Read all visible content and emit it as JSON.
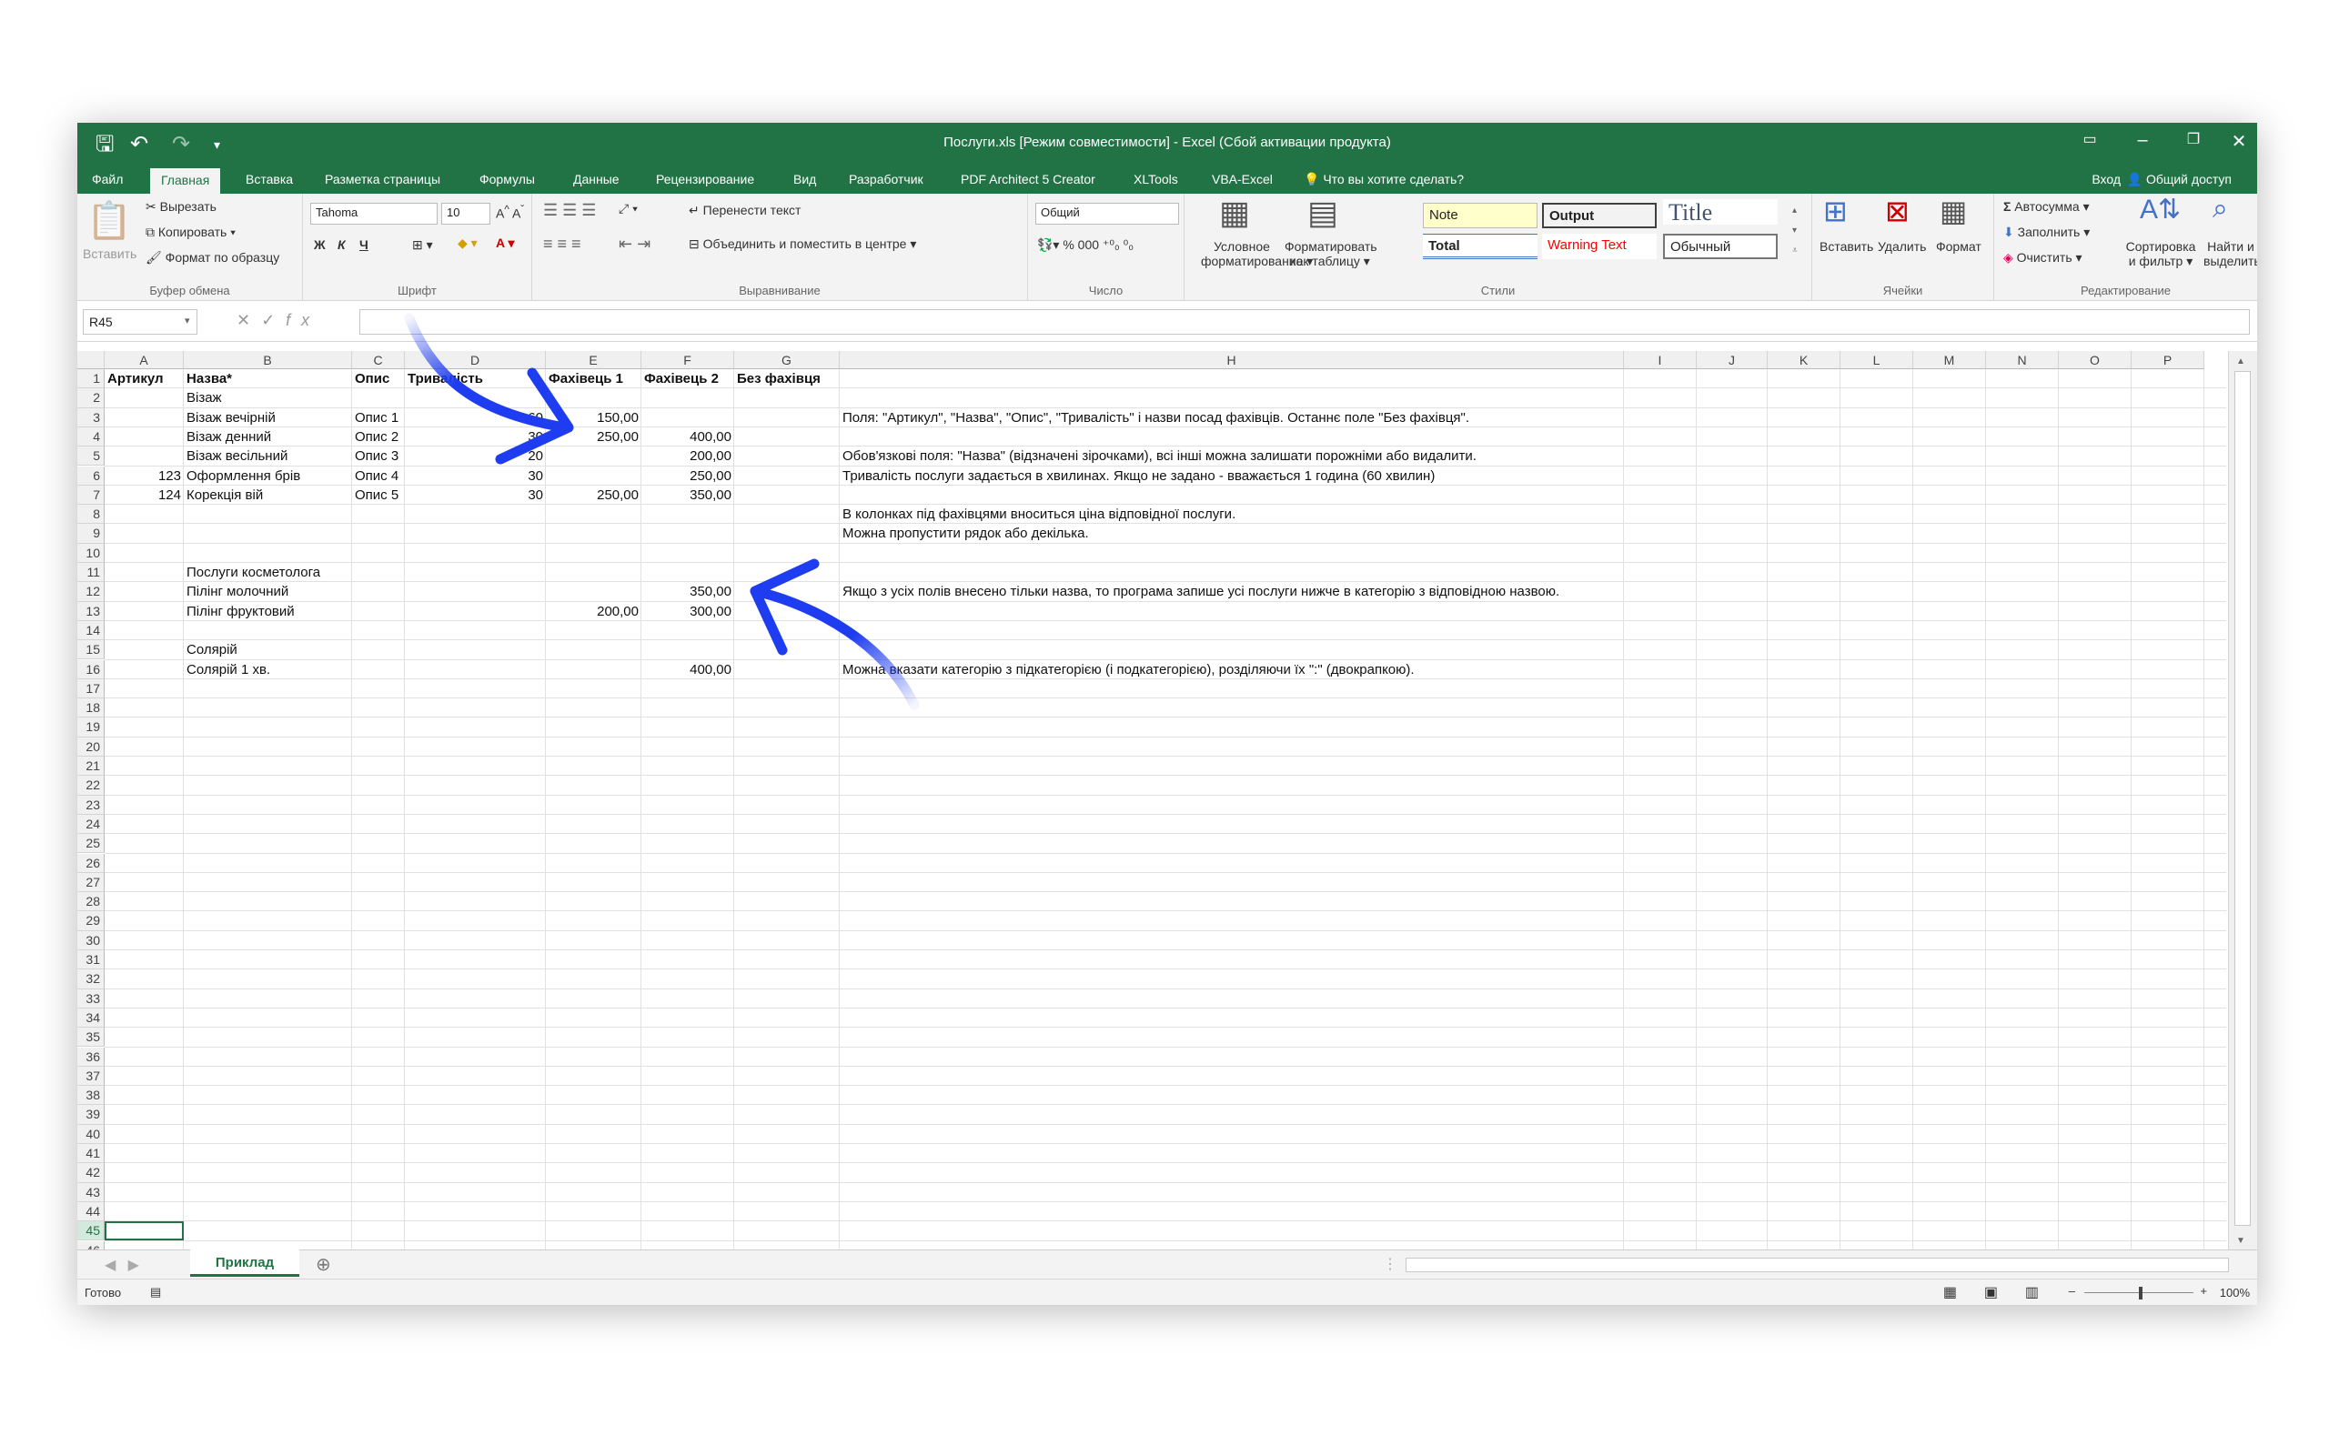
{
  "qat": {
    "save_icon": "save-icon",
    "undo_icon": "undo-icon",
    "redo_icon": "redo-icon",
    "customize_icon": "customize-icon"
  },
  "title": "Послуги.xls  [Режим совместимости] - Excel (Сбой активации продукта)",
  "tabs": [
    "Файл",
    "Главная",
    "Вставка",
    "Разметка страницы",
    "Формулы",
    "Данные",
    "Рецензирование",
    "Вид",
    "Разработчик",
    "PDF Architect 5 Creator",
    "XLTools",
    "VBA-Excel"
  ],
  "tell_me": "Что вы хотите сделать?",
  "signin": "Вход",
  "share": "Общий доступ",
  "ribbon": {
    "clipboard": {
      "paste": "Вставить",
      "cut": "Вырезать",
      "copy": "Копировать",
      "painter": "Формат по образцу",
      "label": "Буфер обмена"
    },
    "font": {
      "name": "Tahoma",
      "size": "10",
      "bold": "Ж",
      "italic": "К",
      "underline": "Ч",
      "label": "Шрифт"
    },
    "align": {
      "wrap": "Перенести текст",
      "merge": "Объединить и поместить в центре",
      "label": "Выравнивание"
    },
    "number": {
      "format": "Общий",
      "label": "Число"
    },
    "styles": {
      "cond1": "Условное",
      "cond2": "форматирование",
      "table1": "Форматировать",
      "table2": "как таблицу",
      "note": "Note",
      "output": "Output",
      "title": "Title",
      "total": "Total",
      "warning": "Warning Text",
      "normal": "Обычный",
      "label": "Стили"
    },
    "cells": {
      "insert": "Вставить",
      "delete": "Удалить",
      "format": "Формат",
      "label": "Ячейки"
    },
    "edit": {
      "autosum": "Автосумма",
      "fill": "Заполнить",
      "clear": "Очистить",
      "sort1": "Сортировка",
      "sort2": "и фильтр",
      "find1": "Найти и",
      "find2": "выделить",
      "label": "Редактирование"
    }
  },
  "namebox": "R45",
  "columns": [
    "A",
    "B",
    "C",
    "D",
    "E",
    "F",
    "G",
    "H",
    "I",
    "J",
    "K",
    "L",
    "M",
    "N",
    "O",
    "P"
  ],
  "rows": [
    [
      "Артикул",
      "Назва*",
      "Опис",
      "Тривалість",
      "Фахівець 1",
      "Фахівець 2",
      "Без фахівця",
      ""
    ],
    [
      "",
      "Візаж",
      "",
      "",
      "",
      "",
      "",
      ""
    ],
    [
      "",
      "Візаж вечірній",
      "Опис 1",
      "60",
      "150,00",
      "",
      "",
      "Поля: \"Артикул\", \"Назва\", \"Опис\", \"Тривалість\" і назви посад фахівців. Останнє поле \"Без фахівця\"."
    ],
    [
      "",
      "Візаж денний",
      "Опис 2",
      "30",
      "250,00",
      "400,00",
      "",
      ""
    ],
    [
      "",
      "Візаж весільний",
      "Опис 3",
      "20",
      "",
      "200,00",
      "",
      "Обов'язкові поля: \"Назва\" (відзначені зірочками), всі інші можна залишати порожніми або видалити."
    ],
    [
      "123",
      "Оформлення брів",
      "Опис 4",
      "30",
      "",
      "250,00",
      "",
      "Тривалість послуги задається в хвилинах. Якщо не задано - вважається 1 година (60 хвилин)"
    ],
    [
      "124",
      "Корекція вій",
      "Опис 5",
      "30",
      "250,00",
      "350,00",
      "",
      ""
    ],
    [
      "",
      "",
      "",
      "",
      "",
      "",
      "",
      "В колонках під фахівцями вноситься ціна відповідної послуги."
    ],
    [
      "",
      "",
      "",
      "",
      "",
      "",
      "",
      "Можна пропустити рядок або декілька."
    ],
    [
      "",
      "",
      "",
      "",
      "",
      "",
      "",
      ""
    ],
    [
      "",
      "Послуги косметолога",
      "",
      "",
      "",
      "",
      "",
      ""
    ],
    [
      "",
      "Пілінг молочний",
      "",
      "",
      "",
      "350,00",
      "",
      "Якщо з усіх полів внесено тільки назва, то програма запише усі послуги нижче в категорію з відповідною назвою."
    ],
    [
      "",
      "Пілінг фруктовий",
      "",
      "",
      "200,00",
      "300,00",
      "",
      ""
    ],
    [
      "",
      "",
      "",
      "",
      "",
      "",
      "",
      ""
    ],
    [
      "",
      "Солярій",
      "",
      "",
      "",
      "",
      "",
      ""
    ],
    [
      "",
      "Солярій 1 хв.",
      "",
      "",
      "",
      "400,00",
      "",
      "Можна вказати категорію з підкатегорією (і подкатегорією), розділяючи їх \":\" (двокрапкою)."
    ]
  ],
  "total_rows": 46,
  "selected_row": "45",
  "sheet_tab": "Приклад",
  "status": {
    "ready": "Готово",
    "zoom": "100%"
  },
  "accent": "#217346",
  "arrow_color": "#1e3cf0"
}
